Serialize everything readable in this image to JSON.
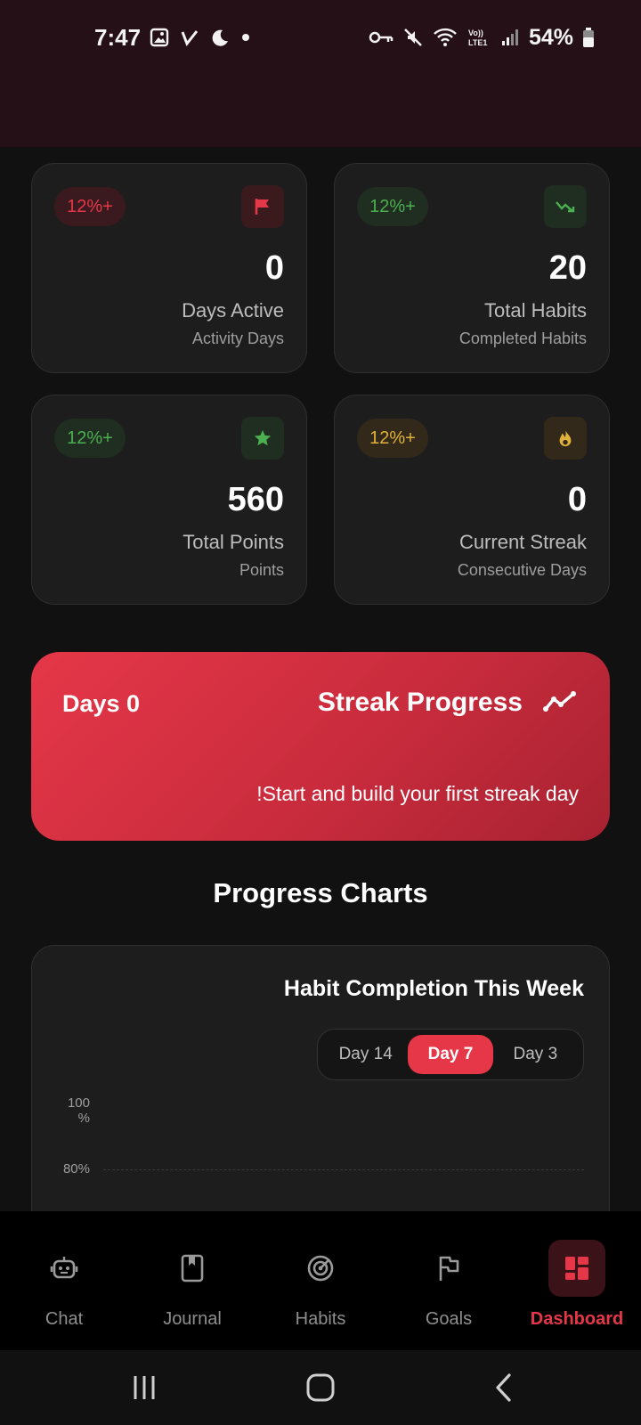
{
  "status_bar": {
    "time": "7:47",
    "battery": "54%",
    "left_icons": [
      "gallery-icon",
      "check-icon",
      "moon-icon",
      "dot-icon"
    ],
    "right_icons": [
      "key-icon",
      "mute-icon",
      "wifi-icon",
      "volte-icon",
      "signal-icon",
      "battery-icon"
    ]
  },
  "stats": [
    {
      "badge": "12%+",
      "value": "0",
      "title": "Days Active",
      "subtitle": "Activity Days",
      "icon": "flag-icon",
      "accent": "#e53748"
    },
    {
      "badge": "12%+",
      "value": "20",
      "title": "Total Habits",
      "subtitle": "Completed Habits",
      "icon": "trend-icon",
      "accent": "#4caf50"
    },
    {
      "badge": "12%+",
      "value": "560",
      "title": "Total Points",
      "subtitle": "Points",
      "icon": "star-icon",
      "accent": "#4caf50"
    },
    {
      "badge": "12%+",
      "value": "0",
      "title": "Current Streak",
      "subtitle": "Consecutive Days",
      "icon": "fire-icon",
      "accent": "#e0b23a"
    }
  ],
  "streak": {
    "days": "Days 0",
    "title": "Streak Progress",
    "message": "!Start and build your first streak day"
  },
  "section_title": "Progress Charts",
  "chart": {
    "title": "Habit Completion This Week",
    "ranges": [
      "Day 14",
      "Day 7",
      "Day 3"
    ],
    "selected_range": "Day 7",
    "y_top_label": "100\n%",
    "y_top_label_line1": "100",
    "y_top_label_line2": "%",
    "y_second_label": "80%"
  },
  "nav": [
    {
      "label": "Chat",
      "icon": "robot-icon"
    },
    {
      "label": "Journal",
      "icon": "book-icon"
    },
    {
      "label": "Habits",
      "icon": "target-icon"
    },
    {
      "label": "Goals",
      "icon": "flag-outline-icon"
    },
    {
      "label": "Dashboard",
      "icon": "dashboard-icon",
      "active": true
    }
  ],
  "colors": {
    "accent_red": "#e53748",
    "accent_green": "#4caf50",
    "accent_yellow": "#e0b23a",
    "background": "#111111",
    "card": "#1d1d1e"
  }
}
